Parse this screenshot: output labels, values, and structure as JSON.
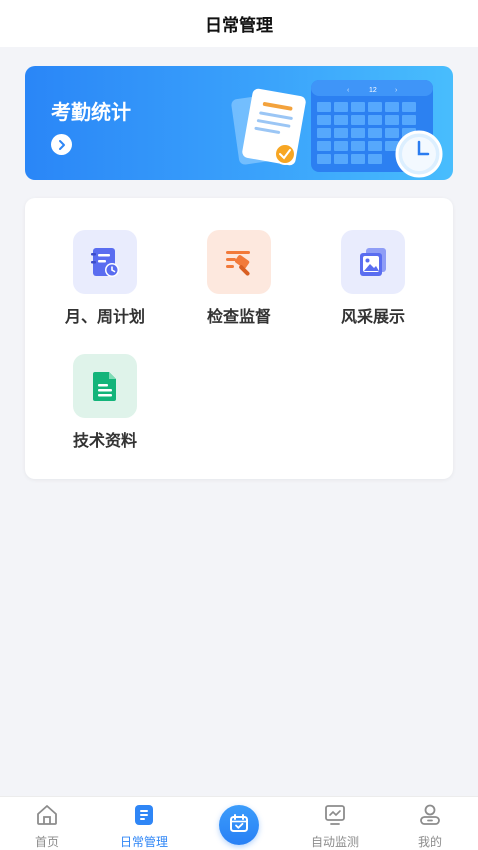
{
  "header": {
    "title": "日常管理"
  },
  "banner": {
    "title": "考勤统计"
  },
  "grid": {
    "items": [
      {
        "label": "月、周计划",
        "icon": "calendar-plan-icon",
        "bg": "#e9ecfd",
        "color": "#5a6df0"
      },
      {
        "label": "检查监督",
        "icon": "inspection-hammer-icon",
        "bg": "#fde8de",
        "color": "#f27a3a"
      },
      {
        "label": "风采展示",
        "icon": "gallery-icon",
        "bg": "#e9ecfd",
        "color": "#5a6df0"
      },
      {
        "label": "技术资料",
        "icon": "document-icon",
        "bg": "#dff3ea",
        "color": "#13b47a"
      }
    ]
  },
  "tabbar": {
    "items": [
      {
        "label": "首页",
        "icon": "home-icon"
      },
      {
        "label": "日常管理",
        "icon": "daily-management-icon",
        "active": true
      },
      {
        "label": "",
        "icon": "calendar-check-icon"
      },
      {
        "label": "自动监测",
        "icon": "monitor-icon"
      },
      {
        "label": "我的",
        "icon": "profile-icon"
      }
    ],
    "active_color": "#2f86f6",
    "inactive_color": "#8c8c8c"
  }
}
